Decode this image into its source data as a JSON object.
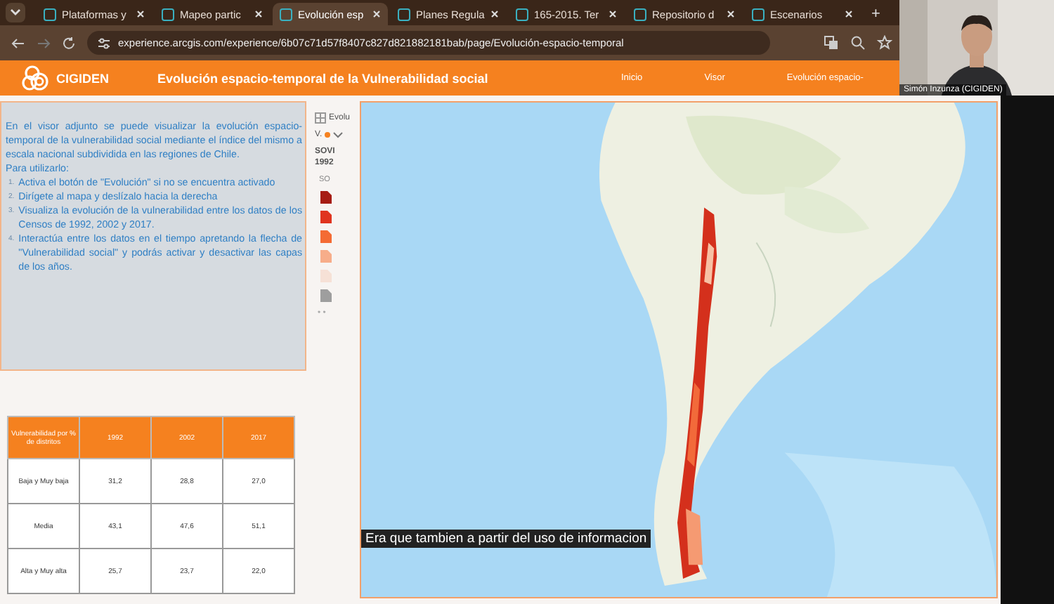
{
  "tabs": [
    {
      "label": "Plataformas y",
      "selected": false
    },
    {
      "label": "Mapeo partic",
      "selected": false
    },
    {
      "label": "Evolución esp",
      "selected": true
    },
    {
      "label": "Planes Regula",
      "selected": false
    },
    {
      "label": "165-2015. Ter",
      "selected": false
    },
    {
      "label": "Repositorio d",
      "selected": false
    },
    {
      "label": "Escenarios",
      "selected": false
    }
  ],
  "new_tab": "+",
  "address_bar": {
    "url": "experience.arcgis.com/experience/6b07c71d57f8407c827d821882181bab/page/Evolución-espacio-temporal"
  },
  "site_header": {
    "logo": "CIGIDEN",
    "title": "Evolución espacio-temporal de la Vulnerabilidad social",
    "nav": [
      {
        "label": "Inicio"
      },
      {
        "label": "Visor"
      },
      {
        "label": "Evolución espacio-"
      }
    ]
  },
  "participant": {
    "name": "Simón Inzunza (CIGIDEN)"
  },
  "intro": {
    "paragraph": "En el visor adjunto se puede visualizar la evolución espacio-temporal de la vulnerabilidad social mediante el índice del mismo a escala nacional subdividida en las regiones de Chile.",
    "list_title": "Para utilizarlo:",
    "step_numbers": [
      "1.",
      "2.",
      "3.",
      "4."
    ],
    "steps": [
      "Activa el botón de \"Evolución\" si no se encuentra activado",
      "Dirígete al mapa y deslízalo hacia la derecha",
      "Visualiza la evolución de la vulnerabilidad entre los datos de los Censos de 1992, 2002 y 2017.",
      "Interactúa entre los datos en el tiempo apretando la flecha de \"Vulnerabilidad social\" y podrás activar y desactivar las capas de los años."
    ]
  },
  "legend": {
    "title": "Evolu",
    "layer": "V.",
    "heading": "SOVI 1992",
    "field": "SO",
    "swatches": [
      {
        "color": "#a61c14"
      },
      {
        "color": "#e0341f"
      },
      {
        "color": "#f46b34"
      },
      {
        "color": "#f7ad8a"
      },
      {
        "color": "#f6e1d6"
      },
      {
        "color": "#9e9e9e"
      }
    ],
    "more": "• •"
  },
  "table": {
    "columns": [
      "Vulnerabilidad por % de distritos",
      "1992",
      "2002",
      "2017"
    ],
    "rows": [
      {
        "cells": [
          "Baja y Muy baja",
          "31,2",
          "28,8",
          "27,0"
        ]
      },
      {
        "cells": [
          "Media",
          "43,1",
          "47,6",
          "51,1"
        ]
      },
      {
        "cells": [
          "Alta y Muy alta",
          "25,7",
          "23,7",
          "22,0"
        ]
      }
    ]
  },
  "caption": "Era que tambien a partir del uso de informacion"
}
